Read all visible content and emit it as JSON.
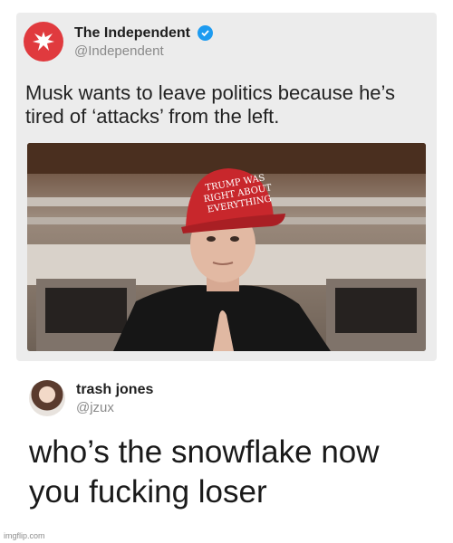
{
  "quoted_tweet": {
    "display_name": "The Independent",
    "handle": "@Independent",
    "text": "Musk wants to leave politics because he’s tired of ‘attacks’ from the left.",
    "hat_text": "TRUMP WAS RIGHT ABOUT EVERYTHING",
    "logo_color": "#e03a3e",
    "verified_color": "#1d9bf0"
  },
  "reply": {
    "display_name": "trash jones",
    "handle": "@jzux",
    "text": "who’s the snowflake now you fucking loser"
  },
  "watermark": "imgflip.com"
}
